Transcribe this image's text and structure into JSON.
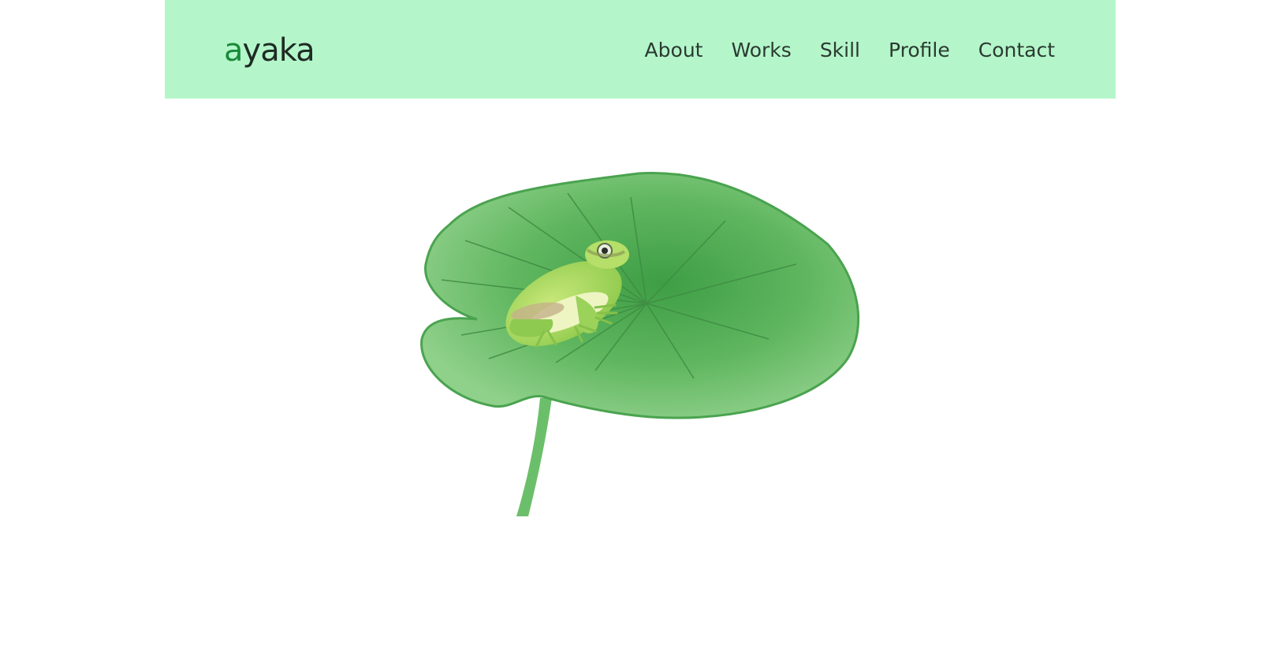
{
  "header": {
    "logo_first": "a",
    "logo_rest": "yaka",
    "nav": [
      "About",
      "Works",
      "Skill",
      "Profile",
      "Contact"
    ]
  },
  "hero": {
    "image": "frog-on-lily-pad-illustration"
  },
  "colors": {
    "header_bg": "#b4f6ca",
    "logo_accent": "#1a8a3a",
    "text": "#2b3a31"
  }
}
